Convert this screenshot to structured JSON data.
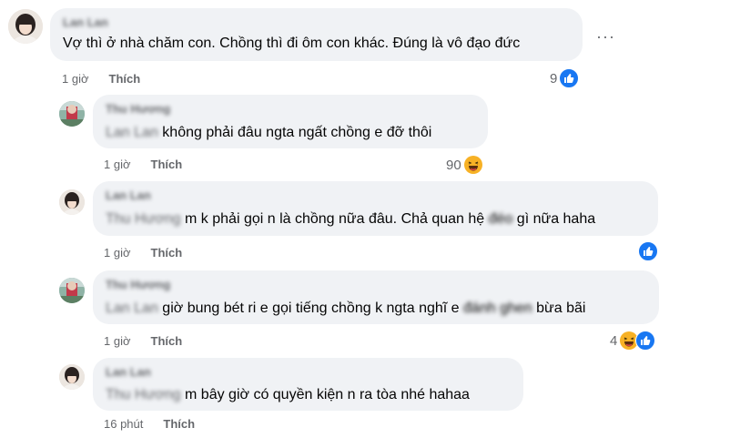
{
  "comments": [
    {
      "name": "Lan Lan",
      "mention": "",
      "text": "Vợ thì ở nhà chăm con. Chồng thì đi ôm con khác. Đúng là vô đạo đức",
      "time": "1 giờ",
      "like_label": "Thích",
      "reaction_count": "9",
      "reaction_icons": [
        "like-icon"
      ]
    },
    {
      "name": "Thu Hương",
      "mention": "Lan Lan",
      "text": "không phải đâu ngta ngất chồng e đỡ thôi",
      "time": "1 giờ",
      "like_label": "Thích",
      "reaction_count": "90",
      "reaction_icons": [
        "haha-icon"
      ]
    },
    {
      "name": "Lan Lan",
      "mention": "Thu Hương",
      "text_a": "m k phải gọi n là chồng nữa đâu. Chả quan hệ ",
      "text_blur": "đéo",
      "text_b": " gì nữa haha",
      "time": "1 giờ",
      "like_label": "Thích",
      "reaction_count": "",
      "reaction_icons": [
        "like-icon"
      ]
    },
    {
      "name": "Thu Hương",
      "mention": "Lan Lan",
      "text_a": "giờ bung bét ri e gọi tiếng chồng k ngta nghĩ e ",
      "text_blur": "đánh ghen",
      "text_b": " bừa bãi",
      "time": "1 giờ",
      "like_label": "Thích",
      "reaction_count": "4",
      "reaction_icons": [
        "haha-icon",
        "like-icon"
      ]
    },
    {
      "name": "Lan Lan",
      "mention": "Thu Hương",
      "text": "m bây giờ có quyền kiện n ra tòa nhé hahaa",
      "time": "16 phút",
      "like_label": "Thích",
      "reaction_count": "",
      "reaction_icons": []
    }
  ],
  "more_label": "···",
  "colors": {
    "bubble": "#f0f2f5",
    "secondary_text": "#65676b",
    "like_blue": "#1877f2",
    "haha_yellow": "#f7b125"
  }
}
